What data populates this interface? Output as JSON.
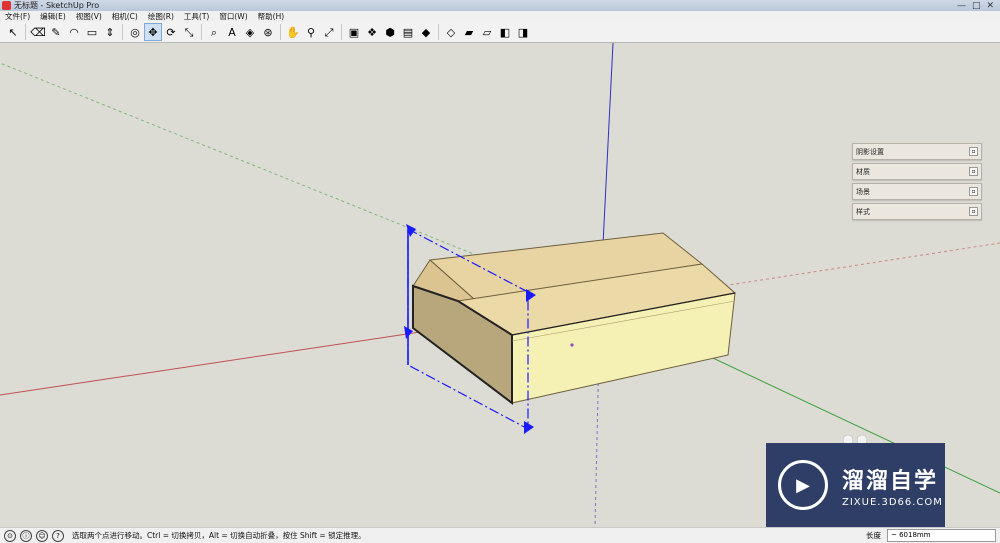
{
  "window": {
    "title": "无标题 - SketchUp Pro",
    "minimize": "—",
    "maximize": "□",
    "close": "✕"
  },
  "menu": [
    "文件(F)",
    "编辑(E)",
    "视图(V)",
    "相机(C)",
    "绘图(R)",
    "工具(T)",
    "窗口(W)",
    "帮助(H)"
  ],
  "toolbar": [
    {
      "name": "select-tool-icon",
      "glyph": "↖"
    },
    {
      "name": "eraser-tool-icon",
      "glyph": "⌫"
    },
    {
      "name": "line-tool-icon",
      "glyph": "✎"
    },
    {
      "name": "arc-tool-icon",
      "glyph": "◠"
    },
    {
      "name": "rectangle-tool-icon",
      "glyph": "▭"
    },
    {
      "name": "pushpull-tool-icon",
      "glyph": "⇕"
    },
    {
      "name": "offset-tool-icon",
      "glyph": "◎"
    },
    {
      "name": "move-tool-icon",
      "glyph": "✥",
      "active": true
    },
    {
      "name": "rotate-tool-icon",
      "glyph": "⟳"
    },
    {
      "name": "scale-tool-icon",
      "glyph": "⤡"
    },
    {
      "name": "tape-measure-tool-icon",
      "glyph": "⌕"
    },
    {
      "name": "text-tool-icon",
      "glyph": "A"
    },
    {
      "name": "paint-bucket-tool-icon",
      "glyph": "◈"
    },
    {
      "name": "orbit-tool-icon",
      "glyph": "⊛"
    },
    {
      "name": "pan-tool-icon",
      "glyph": "✋"
    },
    {
      "name": "zoom-tool-icon",
      "glyph": "⚲"
    },
    {
      "name": "zoom-extents-tool-icon",
      "glyph": "⤢"
    },
    {
      "name": "warehouse-icon",
      "glyph": "▣"
    },
    {
      "name": "extension-warehouse-icon",
      "glyph": "❖"
    },
    {
      "name": "component-icon",
      "glyph": "⬢"
    },
    {
      "name": "layout-icon",
      "glyph": "▤"
    },
    {
      "name": "iso-view-icon",
      "glyph": "◆"
    },
    {
      "name": "top-view-icon",
      "glyph": "◇"
    },
    {
      "name": "front-view-icon",
      "glyph": "▰"
    },
    {
      "name": "right-view-icon",
      "glyph": "▱"
    },
    {
      "name": "back-view-icon",
      "glyph": "◧"
    },
    {
      "name": "left-view-icon",
      "glyph": "◨"
    }
  ],
  "tray": [
    {
      "label": "阴影设置"
    },
    {
      "label": "材质"
    },
    {
      "label": "场景"
    },
    {
      "label": "样式"
    }
  ],
  "status": {
    "hint": "选取两个点进行移动。Ctrl = 切换拷贝，Alt = 切换自动折叠，按住 Shift = 锁定推理。",
    "measure_label": "长度",
    "measure_value": "~ 6018mm"
  },
  "watermark": {
    "brand": "溜溜自学",
    "url": "ZIXUE.3D66.COM"
  },
  "colors": {
    "viewport_bg": "#dcdcd4",
    "face_top": "#e8d3a2",
    "face_front": "#f5f0b4",
    "face_inner": "#b8a77d",
    "selection_blue": "#1a1aff",
    "axis_red": "#c05050",
    "axis_green": "#40a040",
    "axis_blue": "#3030c0"
  }
}
